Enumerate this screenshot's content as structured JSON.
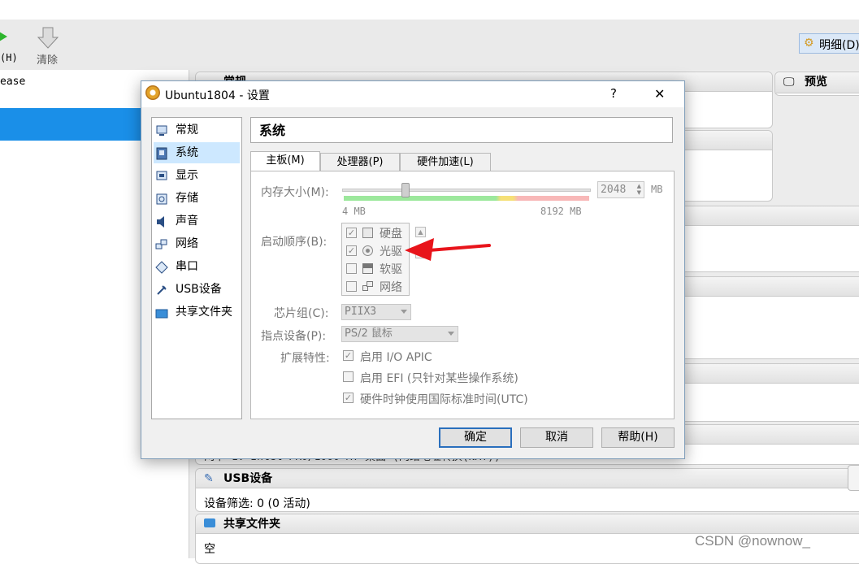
{
  "background_app": {
    "toolbar": {
      "partial_label": "(H)",
      "clear_label": "清除",
      "detail_label": "明细(D)"
    },
    "vm_list": {
      "partial_item": "ease"
    },
    "preview_label": "预览",
    "general_label": "常规",
    "network_line": "网卡 1: Intel PRO/1000 MT 桌面 (网络地址转换(NAT))",
    "usb_section": {
      "title": "USB设备",
      "content": "设备筛选: 0 (0 活动)"
    },
    "shared_section": {
      "title": "共享文件夹",
      "content": "空"
    }
  },
  "dialog": {
    "title": "Ubuntu1804 - 设置",
    "help_glyph": "?",
    "close_glyph": "✕",
    "nav": [
      {
        "label": "常规",
        "icon": "general-icon"
      },
      {
        "label": "系统",
        "icon": "system-icon",
        "selected": true
      },
      {
        "label": "显示",
        "icon": "display-icon"
      },
      {
        "label": "存储",
        "icon": "storage-icon"
      },
      {
        "label": "声音",
        "icon": "audio-icon"
      },
      {
        "label": "网络",
        "icon": "network-icon"
      },
      {
        "label": "串口",
        "icon": "serial-port-icon"
      },
      {
        "label": "USB设备",
        "icon": "usb-icon"
      },
      {
        "label": "共享文件夹",
        "icon": "shared-folder-icon"
      }
    ],
    "section_title": "系统",
    "tabs": [
      "主板(M)",
      "处理器(P)",
      "硬件加速(L)"
    ],
    "memory": {
      "label": "内存大小(M):",
      "value": "2048",
      "unit": "MB",
      "min_label": "4 MB",
      "max_label": "8192 MB",
      "slider_fraction": 0.25
    },
    "boot_order": {
      "label": "启动顺序(B):",
      "items": [
        {
          "label": "硬盘",
          "checked": true,
          "icon": "hard-disk-icon"
        },
        {
          "label": "光驱",
          "checked": true,
          "icon": "optical-drive-icon"
        },
        {
          "label": "软驱",
          "checked": false,
          "icon": "floppy-icon"
        },
        {
          "label": "网络",
          "checked": false,
          "icon": "network-boot-icon"
        }
      ]
    },
    "chipset": {
      "label": "芯片组(C):",
      "value": "PIIX3"
    },
    "pointing": {
      "label": "指点设备(P):",
      "value": "PS/2 鼠标"
    },
    "extended": {
      "label": "扩展特性:",
      "options": [
        {
          "label": "启用 I/O APIC",
          "checked": true
        },
        {
          "label": "启用 EFI (只针对某些操作系统)",
          "checked": false
        },
        {
          "label": "硬件时钟使用国际标准时间(UTC)",
          "checked": true
        }
      ]
    },
    "buttons": {
      "ok": "确定",
      "cancel": "取消",
      "help": "帮助(H)"
    }
  },
  "watermark": "CSDN @nownow_",
  "colors": {
    "selection": "#1a8fe8",
    "nav_selected": "#cde8ff",
    "arrow": "#e8141b"
  }
}
